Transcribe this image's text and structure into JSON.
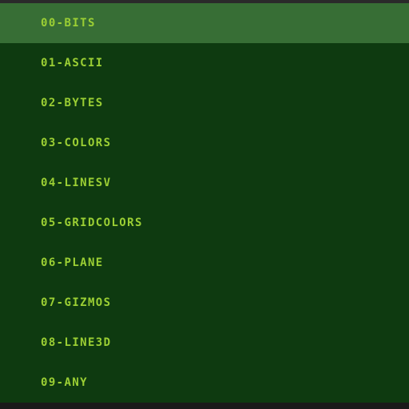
{
  "menu": {
    "selected_index": 0,
    "items": [
      {
        "label": "00-bits"
      },
      {
        "label": "01-ascii"
      },
      {
        "label": "02-bytes"
      },
      {
        "label": "03-colors"
      },
      {
        "label": "04-linesv"
      },
      {
        "label": "05-gridcolors"
      },
      {
        "label": "06-plane"
      },
      {
        "label": "07-gizmos"
      },
      {
        "label": "08-line3d"
      },
      {
        "label": "09-any"
      }
    ]
  },
  "colors": {
    "background": "#0e3a10",
    "selected": "#376e35",
    "text": "#9bcf34"
  }
}
